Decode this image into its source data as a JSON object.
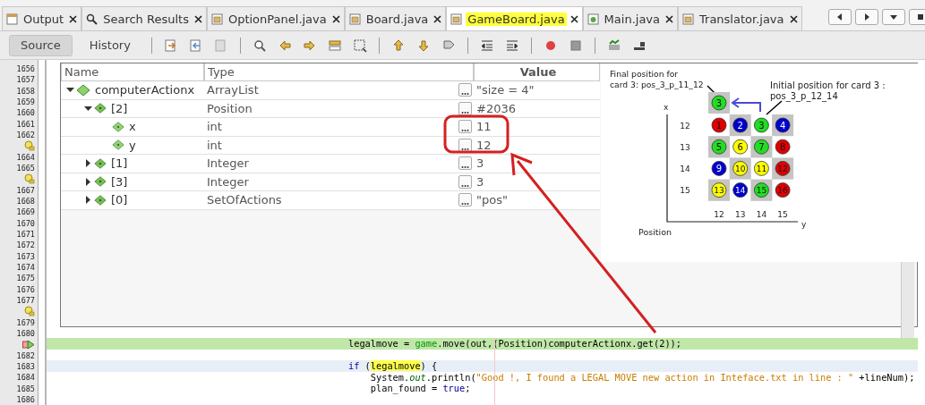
{
  "tabs": [
    {
      "label": "Output",
      "kind": "output",
      "selected": false
    },
    {
      "label": "Search Results",
      "kind": "search",
      "selected": false
    },
    {
      "label": "OptionPanel.java",
      "kind": "java",
      "selected": false
    },
    {
      "label": "Board.java",
      "kind": "java",
      "selected": false
    },
    {
      "label": "GameBoard.java",
      "kind": "java",
      "selected": true
    },
    {
      "label": "Main.java",
      "kind": "main",
      "selected": false
    },
    {
      "label": "Translator.java",
      "kind": "java",
      "selected": false
    }
  ],
  "view_toggle": [
    {
      "label": "Source",
      "selected": true
    },
    {
      "label": "History",
      "selected": false
    }
  ],
  "gutter": [
    {
      "kind": "number",
      "text": "1656"
    },
    {
      "kind": "number",
      "text": "1657"
    },
    {
      "kind": "number",
      "text": "1658"
    },
    {
      "kind": "number",
      "text": "1659"
    },
    {
      "kind": "number",
      "text": "1660"
    },
    {
      "kind": "number",
      "text": "1661"
    },
    {
      "kind": "number",
      "text": "1662"
    },
    {
      "kind": "hint"
    },
    {
      "kind": "number",
      "text": "1664"
    },
    {
      "kind": "number",
      "text": "1665"
    },
    {
      "kind": "hint"
    },
    {
      "kind": "number",
      "text": "1667"
    },
    {
      "kind": "number",
      "text": "1668"
    },
    {
      "kind": "number",
      "text": "1669"
    },
    {
      "kind": "number",
      "text": "1670"
    },
    {
      "kind": "number",
      "text": "1671"
    },
    {
      "kind": "number",
      "text": "1672"
    },
    {
      "kind": "number",
      "text": "1673"
    },
    {
      "kind": "number",
      "text": "1674"
    },
    {
      "kind": "number",
      "text": "1675"
    },
    {
      "kind": "number",
      "text": "1676"
    },
    {
      "kind": "number",
      "text": "1677"
    },
    {
      "kind": "hint"
    },
    {
      "kind": "number",
      "text": "1679"
    },
    {
      "kind": "number",
      "text": "1680"
    },
    {
      "kind": "pc"
    },
    {
      "kind": "number",
      "text": "1682"
    },
    {
      "kind": "number",
      "text": "1683"
    },
    {
      "kind": "number",
      "text": "1684"
    },
    {
      "kind": "number",
      "text": "1685"
    },
    {
      "kind": "number",
      "text": "1686"
    }
  ],
  "variables": {
    "columns": [
      "Name",
      "Type",
      "Value"
    ],
    "rows": [
      {
        "kind": "object",
        "name": "computerActionx",
        "type": "ArrayList",
        "value": "\"size = 4\"",
        "expanded": true,
        "children": [
          {
            "kind": "object",
            "name": "[2]",
            "type": "Position",
            "value": "#2036",
            "expanded": true,
            "children": [
              {
                "kind": "field",
                "name": "x",
                "type": "int",
                "value": "11"
              },
              {
                "kind": "field",
                "name": "y",
                "type": "int",
                "value": "12"
              }
            ]
          },
          {
            "kind": "object",
            "name": "[1]",
            "type": "Integer",
            "value": "3",
            "expanded": false
          },
          {
            "kind": "object",
            "name": "[3]",
            "type": "Integer",
            "value": "3",
            "expanded": false
          },
          {
            "kind": "object",
            "name": "[0]",
            "type": "SetOfActions",
            "value": "\"pos\"",
            "expanded": false
          }
        ]
      }
    ]
  },
  "diagram": {
    "final_label": [
      "Final position for",
      "card 3: pos_3_p_11_12"
    ],
    "initial_label": [
      "Initial position for card 3 :",
      "pos_3_p_12_14"
    ],
    "x_axis": "x",
    "y_axis": "y",
    "title": "Position",
    "row_labels": [
      "12",
      "13",
      "14",
      "15"
    ],
    "col_labels": [
      "12",
      "13",
      "14",
      "15"
    ],
    "moved_card": {
      "label": "3",
      "color": "#22dd22"
    },
    "cards": [
      {
        "label": "1",
        "color": "#e00000"
      },
      {
        "label": "2",
        "color": "#0000cc"
      },
      {
        "label": "3",
        "color": "#22dd22"
      },
      {
        "label": "4",
        "color": "#0000cc"
      },
      {
        "label": "5",
        "color": "#22dd22"
      },
      {
        "label": "6",
        "color": "#ffff00"
      },
      {
        "label": "7",
        "color": "#22dd22"
      },
      {
        "label": "8",
        "color": "#e00000"
      },
      {
        "label": "9",
        "color": "#0000cc"
      },
      {
        "label": "10",
        "color": "#ffff00"
      },
      {
        "label": "11",
        "color": "#ffff00"
      },
      {
        "label": "12",
        "color": "#e00000"
      },
      {
        "label": "13",
        "color": "#ffff00"
      },
      {
        "label": "14",
        "color": "#0000cc"
      },
      {
        "label": "15",
        "color": "#22dd22"
      },
      {
        "label": "16",
        "color": "#e00000"
      }
    ]
  },
  "code": [
    {
      "kind": "current",
      "tokens": [
        {
          "kind": "plain",
          "text": "legalmove = "
        },
        {
          "kind": "member",
          "text": "game"
        },
        {
          "kind": "plain",
          "text": ".move(out,(Position)computerActionx.get(2));"
        }
      ]
    },
    {
      "kind": "plain"
    },
    {
      "kind": "caret",
      "tokens": [
        {
          "kind": "keyword",
          "text": "if"
        },
        {
          "kind": "plain",
          "text": " ("
        },
        {
          "kind": "marked",
          "text": "legalmove"
        },
        {
          "kind": "plain",
          "text": ") {"
        }
      ]
    },
    {
      "kind": "plain",
      "tokens": [
        {
          "kind": "plain",
          "text": "    System."
        },
        {
          "kind": "field",
          "text": "out"
        },
        {
          "kind": "plain",
          "text": ".println("
        },
        {
          "kind": "string",
          "text": "\"Good !, I found a LEGAL MOVE new action in Inteface.txt in line : \""
        },
        {
          "kind": "plain",
          "text": " +lineNum);"
        }
      ]
    },
    {
      "kind": "plain",
      "tokens": [
        {
          "kind": "plain",
          "text": "    plan_found = "
        },
        {
          "kind": "keyword",
          "text": "true"
        },
        {
          "kind": "plain",
          "text": ";"
        }
      ]
    },
    {
      "kind": "plain"
    }
  ]
}
